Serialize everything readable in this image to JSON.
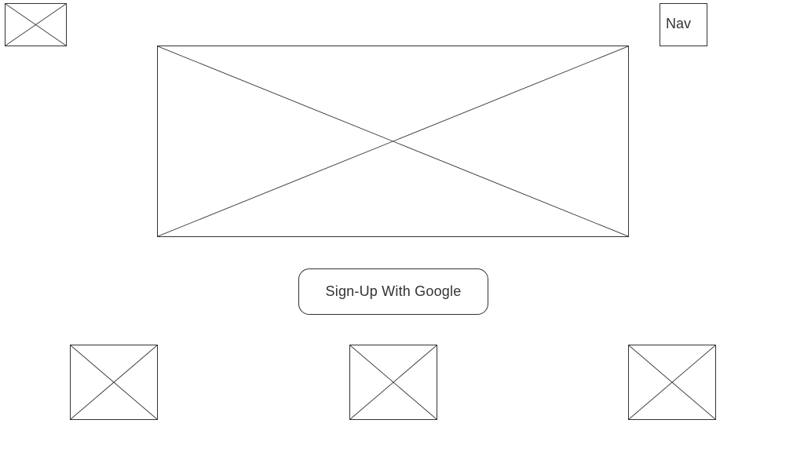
{
  "header": {
    "logo_icon": "image-placeholder-icon",
    "nav_label": "Nav"
  },
  "hero": {
    "image_icon": "image-placeholder-icon"
  },
  "cta": {
    "signup_label": "Sign-Up With Google"
  },
  "features": [
    {
      "image_icon": "image-placeholder-icon"
    },
    {
      "image_icon": "image-placeholder-icon"
    },
    {
      "image_icon": "image-placeholder-icon"
    }
  ],
  "colors": {
    "stroke": "#333333",
    "background": "#ffffff",
    "text": "#333333"
  }
}
